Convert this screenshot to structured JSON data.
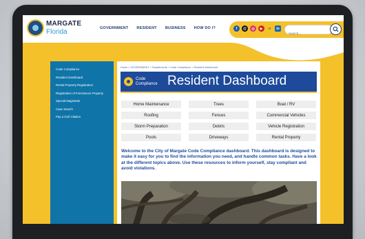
{
  "site": {
    "name": "MARGATE",
    "subtitle": "Florida"
  },
  "nav": {
    "items": [
      "GOVERNMENT",
      "RESIDENT",
      "BUSINESS",
      "HOW DO I?"
    ]
  },
  "social": {
    "icons": [
      "facebook-icon",
      "threads-icon",
      "instagram-icon",
      "youtube-icon",
      "nextdoor-icon",
      "linkedin-icon"
    ]
  },
  "search": {
    "placeholder": "Search..."
  },
  "sidebar": {
    "items": [
      "Code Compliance",
      "Resident Dashboard",
      "Rental Property Registration",
      "Registration of Foreclosure Property",
      "Special Magistrate",
      "Case Search",
      "Pay a Civil Citation"
    ]
  },
  "breadcrumb": "Home > GOVERNMENT > Departments > Code Compliance > Resident Dashboard",
  "banner": {
    "small_line1": "Code",
    "small_line2": "Compliance",
    "title": "Resident Dashboard"
  },
  "topics": [
    "Home Maintenance",
    "Trees",
    "Boat / RV",
    "Roofing",
    "Fences",
    "Commercial Vehicles",
    "Storm Preparation",
    "Debris",
    "Vehicle Registration",
    "Pools",
    "Driveways",
    "Rental Property"
  ],
  "welcome_text": "Welcome to the City of Margate Code Compliance dashboard. This dashboard is designed to make it easy for you to find the information you need, and handle common tasks. Have a look at the different topics above. Use these resources to inform yourself, stay compliant and avoid violations.",
  "colors": {
    "brand_yellow": "#f4c12b",
    "brand_blue": "#1d4a9a",
    "sidebar_blue": "#0f74a8"
  }
}
